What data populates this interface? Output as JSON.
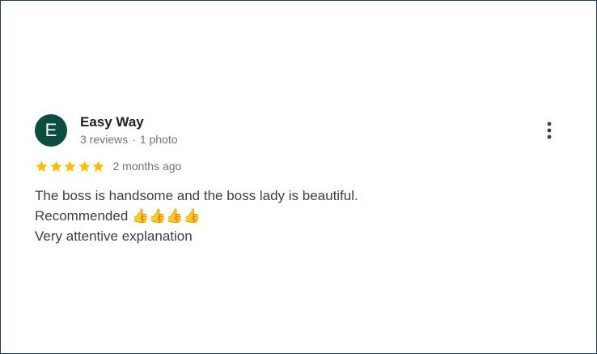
{
  "review": {
    "author": {
      "initial": "E",
      "name": "Easy Way",
      "reviews_count": "3 reviews",
      "separator": "·",
      "photos_count": "1 photo",
      "avatar_color": "#0b4d3f"
    },
    "rating": {
      "stars": 5,
      "max_stars": 5,
      "star_color": "#fbbc04"
    },
    "time_ago": "2 months ago",
    "text": "The boss is handsome and the boss lady is beautiful.\nRecommended 👍👍👍👍\nVery attentive explanation",
    "more_options_icon": "more-vert-icon"
  }
}
